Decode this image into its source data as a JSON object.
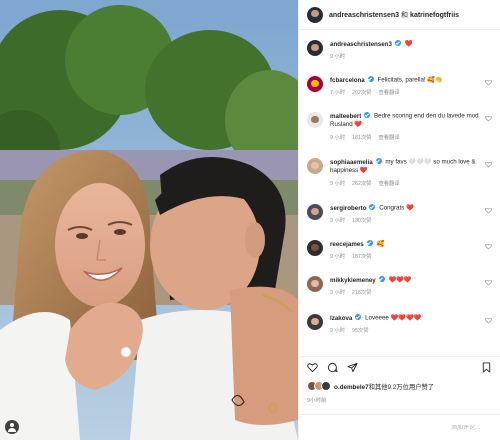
{
  "header": {
    "user1": "andreaschristensen3",
    "separator": "和",
    "user2": "katrinefogtfriis"
  },
  "caption": {
    "user": "andreaschristensen3",
    "text": "❤️",
    "time": "9 小时"
  },
  "comments": [
    {
      "user": "fcbarcelona",
      "verified": true,
      "text": "Felicitats, parella! 🥰👏",
      "time": "7 小时",
      "likes": "202次赞",
      "translate": "查看翻译",
      "avatar_color": "#a50044"
    },
    {
      "user": "malteebert",
      "verified": true,
      "text": "Bedre scoring end den du lavede mod Rusland ❤️",
      "time": "9 小时",
      "likes": "181次赞",
      "translate": "查看翻译",
      "avatar_color": "#6b6b6b"
    },
    {
      "user": "sophiaaemelia",
      "verified": true,
      "text": "my favs 🤍🤍🤍 so much love & happiness ❤️",
      "time": "9 小时",
      "likes": "262次赞",
      "translate": "查看翻译",
      "avatar_color": "#c49a7a"
    },
    {
      "user": "sergiroberto",
      "verified": true,
      "text": "Congrats ❤️",
      "time": "9 小时",
      "likes": "180次赞",
      "translate": "",
      "avatar_color": "#4a4a5a"
    },
    {
      "user": "reecejames",
      "verified": true,
      "text": "🥰",
      "time": "9 小时",
      "likes": "187次赞",
      "translate": "",
      "avatar_color": "#2e2e2e"
    },
    {
      "user": "mikkykiemeney",
      "verified": true,
      "text": "❤️❤️❤️",
      "time": "9 小时",
      "likes": "218次赞",
      "translate": "",
      "avatar_color": "#8a6a55"
    },
    {
      "user": "lzakova",
      "verified": true,
      "text": "Loveeee ❤️❤️❤️❤️",
      "time": "9 小时",
      "likes": "95次赞",
      "translate": "",
      "avatar_color": "#3a3a3a"
    }
  ],
  "likes": {
    "first_user": "o.dembele7",
    "text": "和其他9.2万位用户赞了"
  },
  "post_time": "9小时前",
  "add_comment_placeholder": "添加评论...",
  "colors": {
    "verified": "#3897f0",
    "heart": "#e0245e",
    "meta": "#8e8e8e"
  }
}
